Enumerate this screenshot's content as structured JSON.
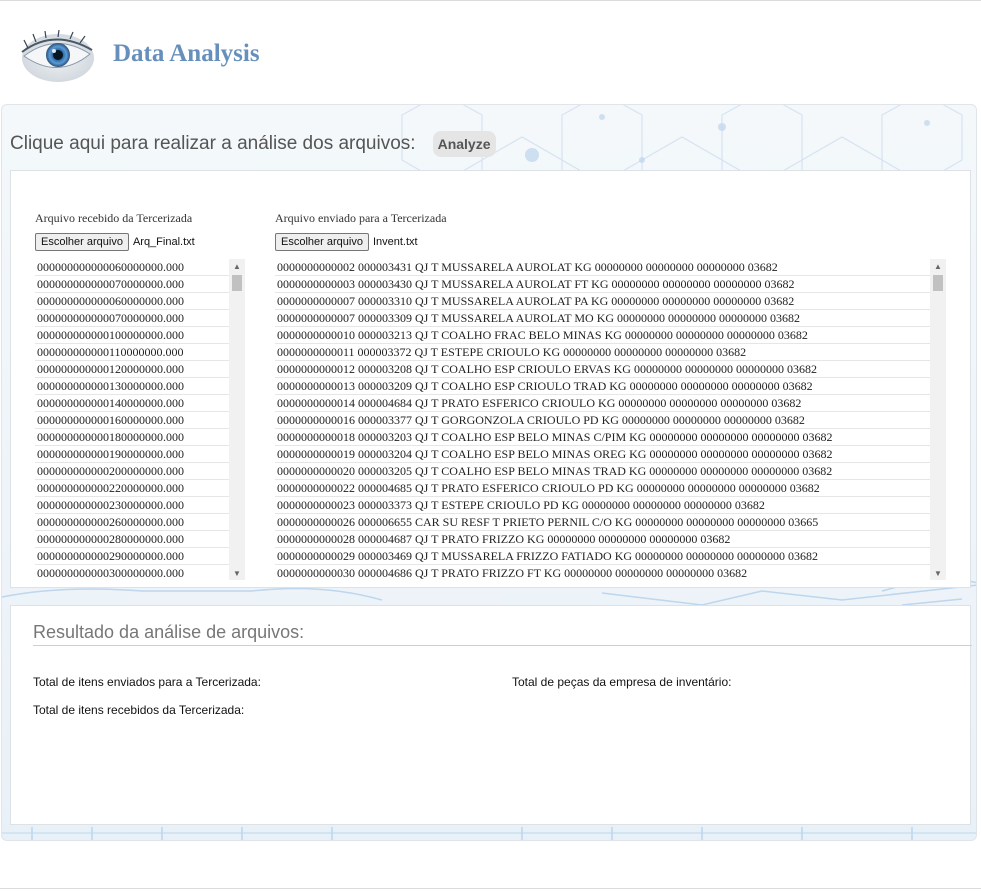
{
  "header": {
    "title": "Data Analysis",
    "logo_icon": "eye-icon"
  },
  "analyze_section": {
    "prompt": "Clique aqui para realizar a análise dos arquivos:",
    "analyze_label": "Analyze"
  },
  "received_file": {
    "label": "Arquivo recebido da Tercerizada",
    "choose_label": "Escolher arquivo",
    "file_name": "Arq_Final.txt",
    "lines": [
      "000000000000060000000.000",
      "000000000000070000000.000",
      "000000000000060000000.000",
      "000000000000070000000.000",
      "000000000000100000000.000",
      "000000000000110000000.000",
      "000000000000120000000.000",
      "000000000000130000000.000",
      "000000000000140000000.000",
      "000000000000160000000.000",
      "000000000000180000000.000",
      "000000000000190000000.000",
      "000000000000200000000.000",
      "000000000000220000000.000",
      "000000000000230000000.000",
      "000000000000260000000.000",
      "000000000000280000000.000",
      "000000000000290000000.000",
      "000000000000300000000.000"
    ]
  },
  "sent_file": {
    "label": "Arquivo enviado para a Tercerizada",
    "choose_label": "Escolher arquivo",
    "file_name": "Invent.txt",
    "lines": [
      "0000000000002 000003431 QJ T MUSSARELA AUROLAT KG 00000000 00000000 00000000 03682",
      "0000000000003 000003430 QJ T MUSSARELA AUROLAT FT KG 00000000 00000000 00000000 03682",
      "0000000000007 000003310 QJ T MUSSARELA AUROLAT PA KG 00000000 00000000 00000000 03682",
      "0000000000007 000003309 QJ T MUSSARELA AUROLAT MO KG 00000000 00000000 00000000 03682",
      "0000000000010 000003213 QJ T COALHO FRAC BELO MINAS KG 00000000 00000000 00000000 03682",
      "0000000000011 000003372 QJ T ESTEPE CRIOULO KG 00000000 00000000 00000000 03682",
      "0000000000012 000003208 QJ T COALHO ESP CRIOULO ERVAS KG 00000000 00000000 00000000 03682",
      "0000000000013 000003209 QJ T COALHO ESP CRIOULO TRAD KG 00000000 00000000 00000000 03682",
      "0000000000014 000004684 QJ T PRATO ESFERICO CRIOULO KG 00000000 00000000 00000000 03682",
      "0000000000016 000003377 QJ T GORGONZOLA CRIOULO PD KG 00000000 00000000 00000000 03682",
      "0000000000018 000003203 QJ T COALHO ESP BELO MINAS C/PIM KG 00000000 00000000 00000000 03682",
      "0000000000019 000003204 QJ T COALHO ESP BELO MINAS OREG KG 00000000 00000000 00000000 03682",
      "0000000000020 000003205 QJ T COALHO ESP BELO MINAS TRAD KG 00000000 00000000 00000000 03682",
      "0000000000022 000004685 QJ T PRATO ESFERICO CRIOULO PD KG 00000000 00000000 00000000 03682",
      "0000000000023 000003373 QJ T ESTEPE CRIOULO PD KG 00000000 00000000 00000000 03682",
      "0000000000026 000006655 CAR SU RESF T PRIETO PERNIL C/O KG 00000000 00000000 00000000 03665",
      "0000000000028 000004687 QJ T PRATO FRIZZO KG 00000000 00000000 00000000 03682",
      "0000000000029 000003469 QJ T MUSSARELA FRIZZO FATIADO KG 00000000 00000000 00000000 03682",
      "0000000000030 000004686 QJ T PRATO FRIZZO FT KG 00000000 00000000 00000000 03682"
    ]
  },
  "results": {
    "title": "Resultado da análise de arquivos:",
    "sent_total_label": "Total de itens enviados para a Tercerizada:",
    "received_total_label": "Total de itens recebidos da Tercerizada:",
    "pieces_total_label": "Total de peças da empresa de inventário:"
  }
}
